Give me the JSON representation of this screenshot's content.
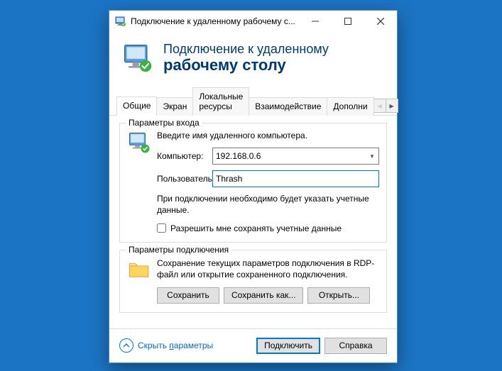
{
  "titlebar": {
    "title": "Подключение к удаленному рабочему с..."
  },
  "header": {
    "line1": "Подключение к удаленному",
    "line2": "рабочему столу"
  },
  "tabs": {
    "items": [
      "Общие",
      "Экран",
      "Локальные ресурсы",
      "Взаимодействие",
      "Дополни"
    ]
  },
  "login_group": {
    "title": "Параметры входа",
    "intro": "Введите имя удаленного компьютера.",
    "computer_label": "Компьютер:",
    "computer_value": "192.168.0.6",
    "user_label": "Пользователь:",
    "user_value": "Thrash",
    "note": "При подключении необходимо будет указать учетные данные.",
    "checkbox_label": "Разрешить мне сохранять учетные данные"
  },
  "conn_group": {
    "title": "Параметры подключения",
    "desc": "Сохранение текущих параметров подключения в RDP-файл или открытие сохраненного подключения.",
    "save": "Сохранить",
    "save_as": "Сохранить как...",
    "open": "Открыть..."
  },
  "footer": {
    "hide_params_pre": "Скрыть ",
    "hide_params_u": "п",
    "hide_params_post": "араметры",
    "connect": "Подключить",
    "help": "Справка"
  }
}
